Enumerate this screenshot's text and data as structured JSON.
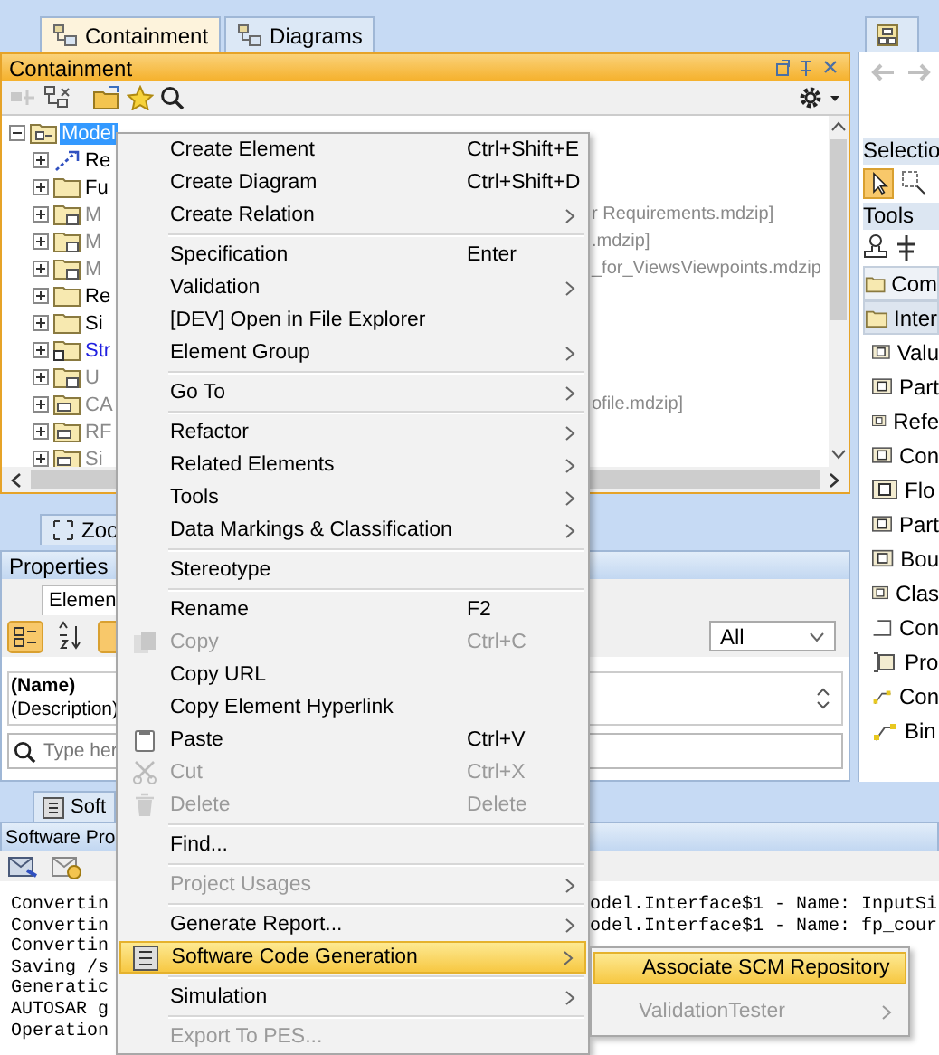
{
  "left_tabs": [
    {
      "label": "Containment",
      "selected": true
    },
    {
      "label": "Diagrams",
      "selected": false
    }
  ],
  "containment": {
    "title": "Containment",
    "tree": {
      "label": "Model",
      "selected": true,
      "expanded": true,
      "children": [
        {
          "label": "Re",
          "kind": "relation",
          "expanded": false
        },
        {
          "label": "Fu",
          "kind": "package",
          "expanded": false
        },
        {
          "label": "M",
          "tail": "r Requirements.mdzip]",
          "kind": "used",
          "expanded": false
        },
        {
          "label": "M",
          "tail": ".mdzip]",
          "kind": "used",
          "expanded": false
        },
        {
          "label": "M",
          "tail": "_for_ViewsViewpoints.mdzip",
          "kind": "used",
          "expanded": false
        },
        {
          "label": "Re",
          "kind": "package",
          "expanded": false
        },
        {
          "label": "Si",
          "kind": "package",
          "expanded": false
        },
        {
          "label": "Str",
          "kind": "linked",
          "expanded": false
        },
        {
          "label": "U",
          "kind": "used",
          "expanded": false
        },
        {
          "label": "CA",
          "tail": "ofile.mdzip]",
          "kind": "profile",
          "expanded": false
        },
        {
          "label": "RF",
          "kind": "profile",
          "expanded": false
        },
        {
          "label": "Si",
          "kind": "profile",
          "expanded": false
        }
      ]
    }
  },
  "zoom_tab": {
    "label": "Zoo"
  },
  "properties": {
    "title": "Properties",
    "tab": "Elemen",
    "filter": "All",
    "name_label": "(Name)",
    "description_label": "(Description)",
    "search": {
      "placeholder": "Type her"
    }
  },
  "palette": {
    "selection_title": "Selectio",
    "tools_title": "Tools",
    "groups": [
      {
        "label": "Com",
        "selected": false
      },
      {
        "label": "Inter",
        "selected": true
      }
    ],
    "items": [
      {
        "label": "Valu",
        "kind": "badge"
      },
      {
        "label": "Part",
        "kind": "badge"
      },
      {
        "label": "Refe",
        "kind": "badge"
      },
      {
        "label": "Con",
        "kind": "badge"
      },
      {
        "label": "Flo",
        "kind": "badge"
      },
      {
        "label": "Part",
        "kind": "badge"
      },
      {
        "label": "Bou",
        "kind": "badge"
      },
      {
        "label": "Clas",
        "kind": "badge"
      },
      {
        "label": "Con",
        "kind": "frame"
      },
      {
        "label": "Pro",
        "kind": "port"
      },
      {
        "label": "Con",
        "kind": "connector"
      },
      {
        "label": "Bin",
        "kind": "connector"
      }
    ]
  },
  "output": {
    "tab": "Soft",
    "title": "Software Pro",
    "lines": [
      {
        "text": "Convertin",
        "tail": "odel.Interface$1 - Name: InputSi"
      },
      {
        "text": "Convertin",
        "tail": "odel.Interface$1 - Name: fp_cour"
      },
      {
        "text": "Convertin"
      },
      {
        "text": "Saving /s"
      },
      {
        "text": "Generatic"
      },
      {
        "text": "AUTOSAR g"
      },
      {
        "text": "Operation"
      }
    ]
  },
  "menu": {
    "items": [
      {
        "kind": "item",
        "label": "Create Element",
        "shortcut": "Ctrl+Shift+E",
        "submenu": false,
        "disabled": false,
        "selected": false
      },
      {
        "kind": "item",
        "label": "Create Diagram",
        "shortcut": "Ctrl+Shift+D",
        "submenu": false,
        "disabled": false,
        "selected": false
      },
      {
        "kind": "item",
        "label": "Create Relation",
        "submenu": true,
        "disabled": false,
        "selected": false
      },
      {
        "kind": "separator"
      },
      {
        "kind": "item",
        "label": "Specification",
        "shortcut": "Enter",
        "submenu": false,
        "disabled": false,
        "selected": false
      },
      {
        "kind": "item",
        "label": "Validation",
        "submenu": true,
        "disabled": false,
        "selected": false
      },
      {
        "kind": "item",
        "label": "[DEV] Open in File Explorer",
        "submenu": false,
        "disabled": false,
        "selected": false
      },
      {
        "kind": "item",
        "label": "Element Group",
        "submenu": true,
        "disabled": false,
        "selected": false
      },
      {
        "kind": "separator"
      },
      {
        "kind": "item",
        "label": "Go To",
        "submenu": true,
        "disabled": false,
        "selected": false
      },
      {
        "kind": "separator"
      },
      {
        "kind": "item",
        "label": "Refactor",
        "submenu": true,
        "disabled": false,
        "selected": false
      },
      {
        "kind": "item",
        "label": "Related Elements",
        "submenu": true,
        "disabled": false,
        "selected": false
      },
      {
        "kind": "item",
        "label": "Tools",
        "submenu": true,
        "disabled": false,
        "selected": false
      },
      {
        "kind": "item",
        "label": "Data Markings & Classification",
        "submenu": true,
        "disabled": false,
        "selected": false
      },
      {
        "kind": "separator"
      },
      {
        "kind": "item",
        "label": "Stereotype",
        "submenu": false,
        "disabled": false,
        "selected": false
      },
      {
        "kind": "separator"
      },
      {
        "kind": "item",
        "label": "Rename",
        "shortcut": "F2",
        "submenu": false,
        "disabled": false,
        "selected": false
      },
      {
        "kind": "copy",
        "label": "Copy",
        "shortcut": "Ctrl+C",
        "submenu": false,
        "disabled": true,
        "selected": false
      },
      {
        "kind": "item",
        "label": "Copy URL",
        "submenu": false,
        "disabled": false,
        "selected": false
      },
      {
        "kind": "item",
        "label": "Copy Element Hyperlink",
        "submenu": false,
        "disabled": false,
        "selected": false
      },
      {
        "kind": "paste",
        "label": "Paste",
        "shortcut": "Ctrl+V",
        "submenu": false,
        "disabled": false,
        "selected": false
      },
      {
        "kind": "cut",
        "label": "Cut",
        "shortcut": "Ctrl+X",
        "submenu": false,
        "disabled": true,
        "selected": false
      },
      {
        "kind": "delete",
        "label": "Delete",
        "shortcut": "Delete",
        "submenu": false,
        "disabled": true,
        "selected": false
      },
      {
        "kind": "separator"
      },
      {
        "kind": "item",
        "label": "Find...",
        "submenu": false,
        "disabled": false,
        "selected": false
      },
      {
        "kind": "separator"
      },
      {
        "kind": "item",
        "label": "Project Usages",
        "submenu": true,
        "disabled": true,
        "selected": false
      },
      {
        "kind": "separator"
      },
      {
        "kind": "item",
        "label": "Generate Report...",
        "submenu": true,
        "disabled": false,
        "selected": false
      },
      {
        "kind": "codegen",
        "label": "Software Code Generation",
        "submenu": true,
        "disabled": false,
        "selected": true
      },
      {
        "kind": "separator"
      },
      {
        "kind": "item",
        "label": "Simulation",
        "submenu": true,
        "disabled": false,
        "selected": false
      },
      {
        "kind": "separator"
      },
      {
        "kind": "item",
        "label": "Export To PES...",
        "submenu": false,
        "disabled": true,
        "selected": false
      }
    ]
  },
  "submenu": {
    "items": [
      {
        "label": "Associate SCM Repository",
        "submenu": false,
        "disabled": false,
        "selected": true
      },
      {
        "label": "ValidationTester",
        "submenu": true,
        "disabled": true,
        "selected": false
      }
    ]
  }
}
